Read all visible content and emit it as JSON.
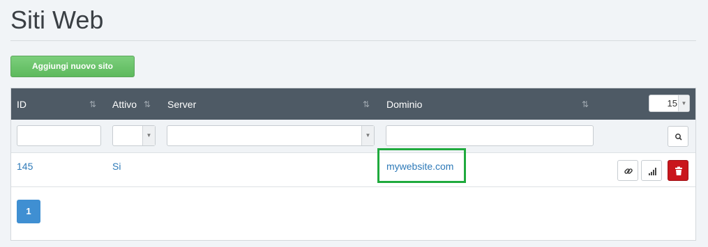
{
  "page": {
    "title": "Siti Web"
  },
  "toolbar": {
    "add_label": "Aggiungi nuovo sito"
  },
  "table": {
    "columns": [
      {
        "label": "ID"
      },
      {
        "label": "Attivo"
      },
      {
        "label": "Server"
      },
      {
        "label": "Dominio"
      }
    ],
    "page_size": "15",
    "sort_glyph": "⇅",
    "rows": [
      {
        "id": "145",
        "attivo": "Si",
        "server": "",
        "dominio": "mywebsite.com"
      }
    ]
  },
  "pagination": {
    "current": "1"
  },
  "colors": {
    "header_bg": "#4e5a65",
    "accent": "#3f8fd2",
    "success": "#5db95d",
    "danger": "#c9161c",
    "highlight": "#1faa3d"
  }
}
